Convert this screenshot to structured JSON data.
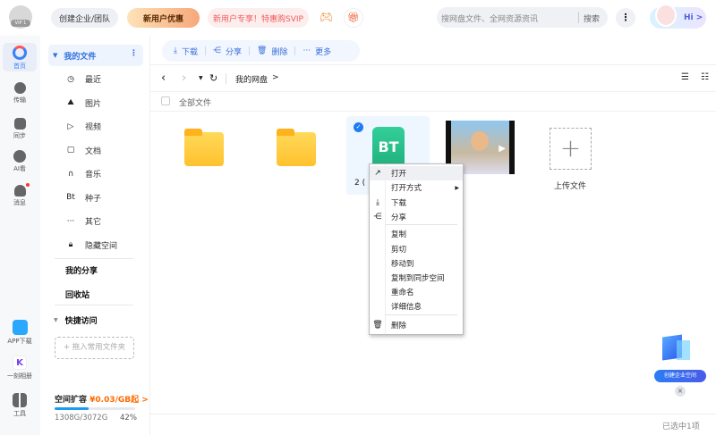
{
  "header": {
    "logo_text": "VIP 1",
    "create_team": "创建企业/团队",
    "new_user_offer": "新用户优惠",
    "svip_promo": "新用户专享！特惠购SVIP",
    "search_placeholder": "搜网盘文件、全网资源资讯",
    "search_button": "搜索",
    "hi_label": "Hi >"
  },
  "rail": {
    "items": [
      {
        "label": "首页",
        "color": "#3b82f6"
      },
      {
        "label": "传输"
      },
      {
        "label": "同步"
      },
      {
        "label": "AI看"
      },
      {
        "label": "消息"
      }
    ],
    "bottom": [
      {
        "label": "APP下载"
      },
      {
        "label": "一刻相册"
      },
      {
        "label": "工具"
      }
    ]
  },
  "sidebar": {
    "my_files": "我的文件",
    "items": [
      {
        "icon": "clock-icon",
        "glyph": "◷",
        "label": "最近"
      },
      {
        "icon": "image-icon",
        "glyph": "⛰",
        "label": "图片"
      },
      {
        "icon": "video-icon",
        "glyph": "▷",
        "label": "视频"
      },
      {
        "icon": "document-icon",
        "glyph": "▢",
        "label": "文档"
      },
      {
        "icon": "music-icon",
        "glyph": "∩",
        "label": "音乐"
      },
      {
        "icon": "bt-icon",
        "glyph": "Bt",
        "label": "种子"
      },
      {
        "icon": "more-icon",
        "glyph": "···",
        "label": "其它"
      },
      {
        "icon": "lock-icon",
        "glyph": "🔒︎",
        "label": "隐藏空间"
      }
    ],
    "my_share": "我的分享",
    "recycle_bin": "回收站",
    "quick_access": "快捷访问",
    "drag_hint": "+ 拖入常用文件夹",
    "storage_title": "空间扩容",
    "storage_offer": "¥0.03/GB起 >",
    "storage_used": "1308G/3072G",
    "storage_percent_label": "42%",
    "storage_percent": 42
  },
  "toolbar": {
    "download": "下载",
    "share": "分享",
    "delete": "删除",
    "more": "更多"
  },
  "nav": {
    "breadcrumb": "我的网盘",
    "breadcrumb_arrow": ">",
    "all_files": "全部文件"
  },
  "files": [
    {
      "type": "folder",
      "name": ""
    },
    {
      "type": "folder",
      "name": ""
    },
    {
      "type": "bt",
      "name": "2 (",
      "selected": true,
      "badge": "BT"
    },
    {
      "type": "video",
      "name": ""
    }
  ],
  "upload_label": "上传文件",
  "context_menu": {
    "items": [
      "打开",
      "打开方式",
      "下载",
      "分享",
      "复制",
      "剪切",
      "移动到",
      "复制到同步空间",
      "重命名",
      "详细信息",
      "删除"
    ]
  },
  "promo": {
    "create_enterprise": "创建企业空间"
  },
  "status": {
    "selected": "已选中1项"
  }
}
